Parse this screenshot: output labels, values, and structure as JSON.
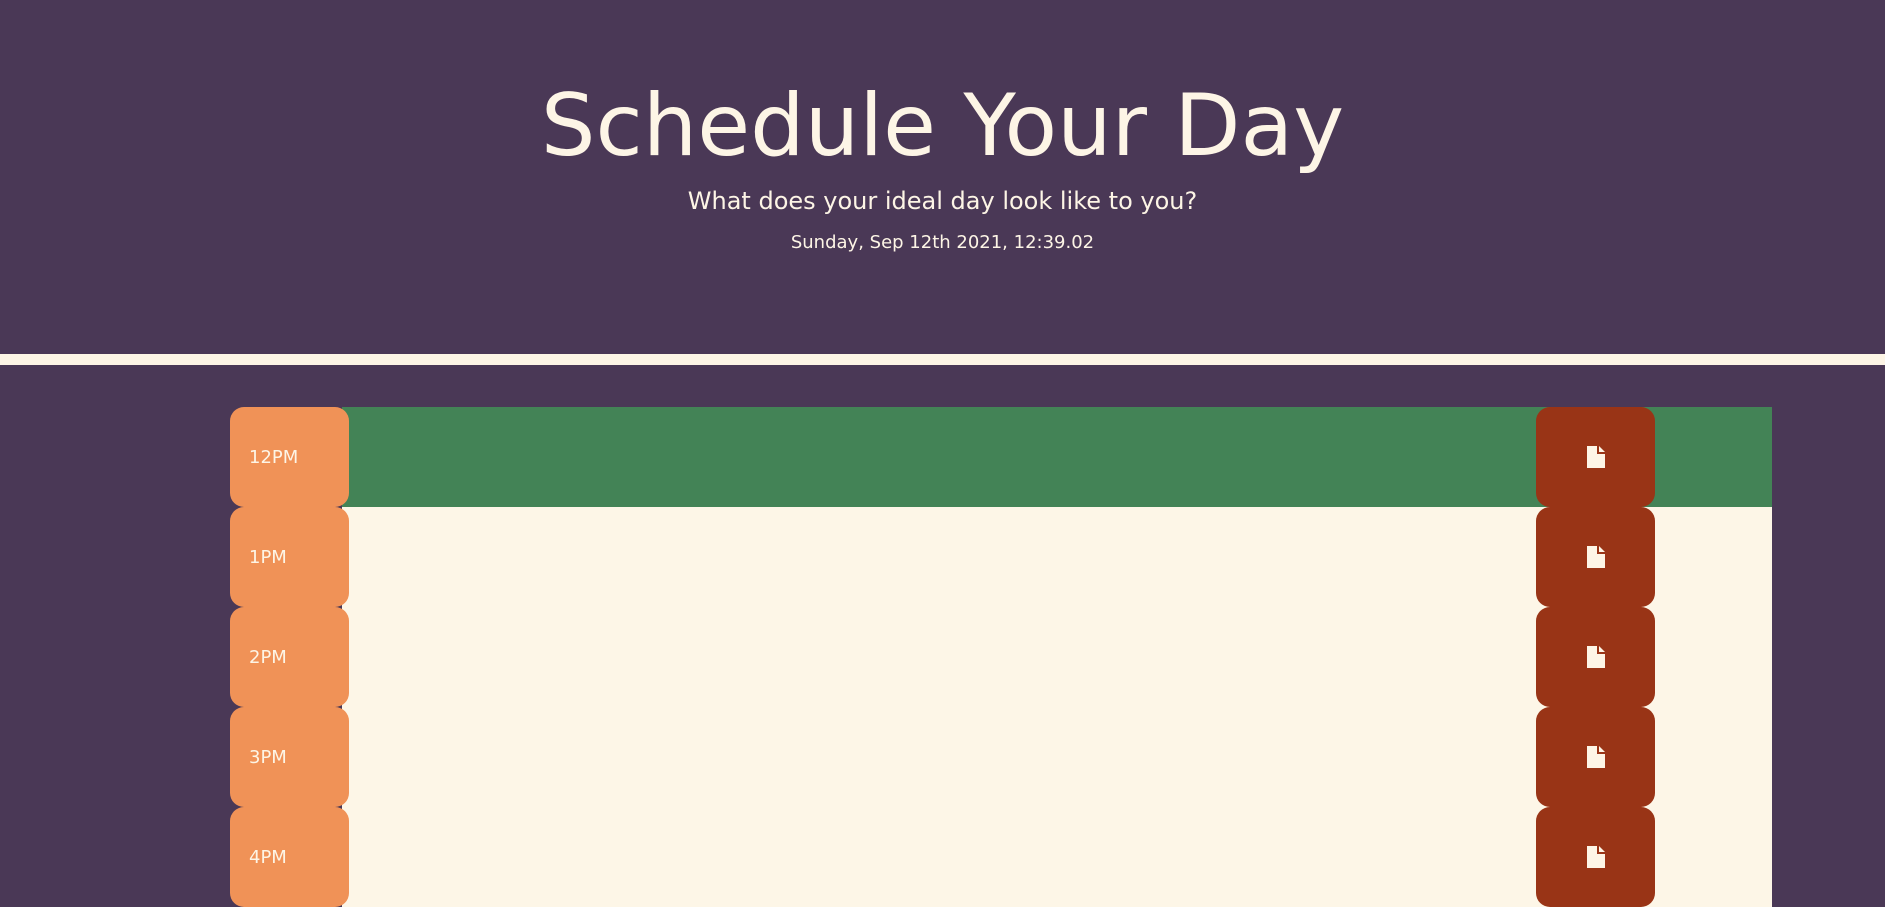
{
  "header": {
    "title": "Schedule Your Day",
    "subtitle": "What does your ideal day look like to you?",
    "date": "Sunday, Sep 12th 2021, 12:39.02"
  },
  "colors": {
    "background": "#4a3856",
    "text": "#fdf5e6",
    "hour_block": "#f09257",
    "present": "#438356",
    "future": "#fdf6e7",
    "save_button": "#993416"
  },
  "time_blocks": [
    {
      "hour": "12PM",
      "status": "present",
      "task": "",
      "save_icon": "file-icon"
    },
    {
      "hour": "1PM",
      "status": "future",
      "task": "",
      "save_icon": "file-icon"
    },
    {
      "hour": "2PM",
      "status": "future",
      "task": "",
      "save_icon": "file-icon"
    },
    {
      "hour": "3PM",
      "status": "future",
      "task": "",
      "save_icon": "file-icon"
    },
    {
      "hour": "4PM",
      "status": "future",
      "task": "",
      "save_icon": "file-icon"
    }
  ]
}
